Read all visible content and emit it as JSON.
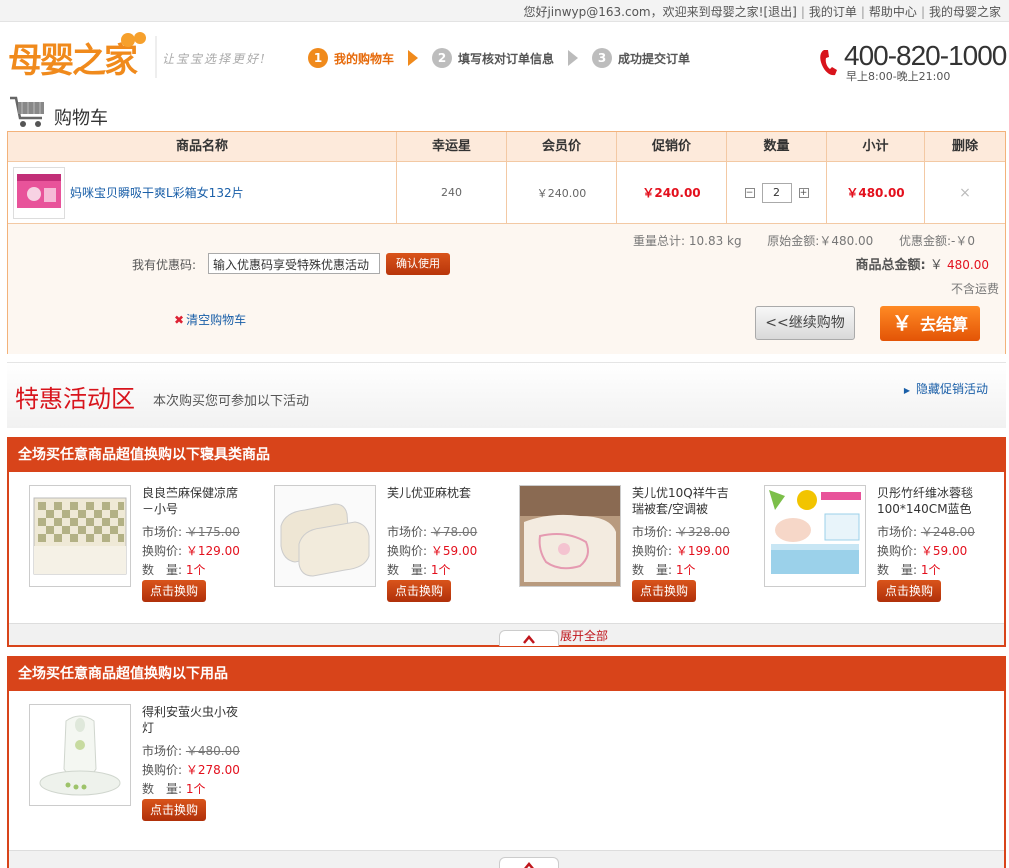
{
  "topbar": {
    "greeting": "您好jinwyp@163.com，欢迎来到母婴之家!",
    "logout": "[退出]",
    "my_orders": "我的订单",
    "help": "帮助中心",
    "my_home": "我的母婴之家"
  },
  "header": {
    "logo_text": "母婴之家",
    "slogan": "让宝宝选择更好!",
    "steps": [
      {
        "num": "1",
        "label": "我的购物车"
      },
      {
        "num": "2",
        "label": "填写核对订单信息"
      },
      {
        "num": "3",
        "label": "成功提交订单"
      }
    ],
    "phone": "400-820-1000",
    "hours": "早上8:00-晚上21:00"
  },
  "cart": {
    "title": "购物车",
    "columns": [
      "商品名称",
      "幸运星",
      "会员价",
      "促销价",
      "数量",
      "小计",
      "删除"
    ],
    "rows": [
      {
        "name": "妈咪宝贝瞬吸干爽L彩箱女132片",
        "lucky_stars": "240",
        "member_price": "￥240.00",
        "promo_price": "￥240.00",
        "qty": "2",
        "subtotal": "￥480.00",
        "delete": "×"
      }
    ],
    "qty_minus": "−",
    "qty_plus": "+",
    "weight_label": "重量总计:",
    "weight_value": "10.83",
    "weight_unit": "kg",
    "orig_label": "原始金额:",
    "orig_value": "￥480.00",
    "discount_label": "优惠金额:",
    "discount_value": "-￥0",
    "coupon_label": "我有优惠码:",
    "coupon_value": "输入优惠码享受特殊优惠活动",
    "coupon_btn": "确认使用",
    "total_label": "商品总金额:",
    "total_currency": "￥",
    "total_value": "480.00",
    "shipping_note": "不含运费",
    "clear_icon": "✖",
    "clear_cart": "清空购物车",
    "continue_btn": "<<继续购物",
    "checkout_currency": "￥",
    "checkout_btn": "去结算"
  },
  "promo": {
    "title": "特惠活动区",
    "subtitle": "本次购买您可参加以下活动",
    "hide": "隐藏促销活动",
    "market_label": "市场价:",
    "swap_label": "换购价:",
    "qty_label": "数　量:",
    "swap_btn": "点击换购",
    "groups": [
      {
        "title": "全场买任意商品超值换购以下寝具类商品",
        "expand": "展开全部",
        "items": [
          {
            "name": "良良苎麻保健凉席－小号",
            "market": "￥175.00",
            "swap": "￥129.00",
            "qty": "1个",
            "img": "mat"
          },
          {
            "name": "芙儿优亚麻枕套",
            "market": "￥78.00",
            "swap": "￥59.00",
            "qty": "1个",
            "img": "pillow"
          },
          {
            "name": "芙儿优10Q祥牛吉瑞被套/空调被",
            "market": "￥328.00",
            "swap": "￥199.00",
            "qty": "1个",
            "img": "quilt"
          },
          {
            "name": "贝彤竹纤维冰蓉毯100*140CM蓝色",
            "market": "￥248.00",
            "swap": "￥59.00",
            "qty": "1个",
            "img": "blanket"
          }
        ]
      },
      {
        "title": "全场买任意商品超值换购以下用品",
        "expand": "",
        "items": [
          {
            "name": "得利安萤火虫小夜灯",
            "market": "￥480.00",
            "swap": "￥278.00",
            "qty": "1个",
            "img": "nightlight"
          }
        ]
      }
    ]
  },
  "colors": {
    "accent_orange": "#f08a1c",
    "promo_red": "#d8441a",
    "price_red": "#e3101d",
    "link_blue": "#1a5fa8"
  }
}
